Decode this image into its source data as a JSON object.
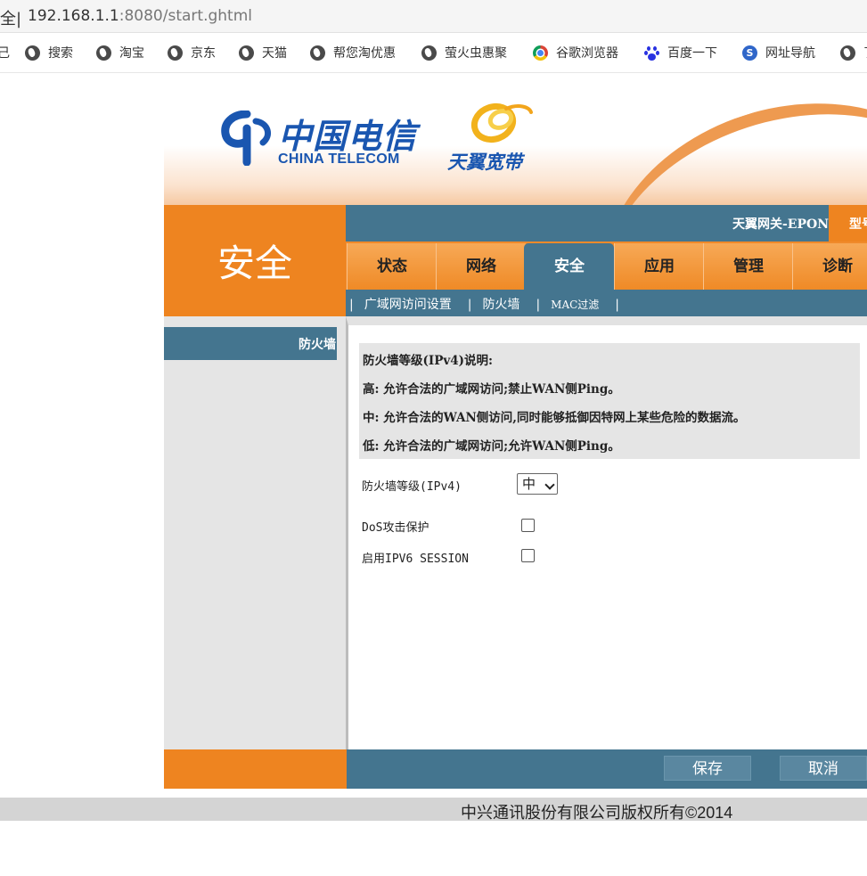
{
  "browser": {
    "address_prefix": "全",
    "url_host": "192.168.1.1",
    "url_rest": ":8080/start.ghtml",
    "bookmarks": [
      {
        "label": "搜索",
        "icon": "globe-icon"
      },
      {
        "label": "淘宝",
        "icon": "globe-icon"
      },
      {
        "label": "京东",
        "icon": "globe-icon"
      },
      {
        "label": "天猫",
        "icon": "globe-icon"
      },
      {
        "label": "帮您淘优惠",
        "icon": "globe-icon"
      },
      {
        "label": "萤火虫惠聚",
        "icon": "globe-icon"
      },
      {
        "label": "谷歌浏览器",
        "icon": "chrome-icon"
      },
      {
        "label": "百度一下",
        "icon": "baidu-paw-icon"
      },
      {
        "label": "网址导航",
        "icon": "360-icon"
      }
    ],
    "bookmark_edge_left": "己",
    "bookmark_edge_right": "了"
  },
  "header": {
    "logo_cn": "中国电信",
    "logo_en": "CHINA TELECOM",
    "brand": "天翼宽带",
    "device_name": "天翼网关-EPON",
    "model_label": "型号"
  },
  "section": {
    "title": "安全"
  },
  "tabs": [
    "状态",
    "网络",
    "安全",
    "应用",
    "管理",
    "诊断"
  ],
  "active_tab": "安全",
  "subtabs": {
    "items": [
      "广域网访问设置",
      "防火墙",
      "MAC过滤"
    ],
    "separator": "|"
  },
  "left_menu": {
    "active_item": "防火墙"
  },
  "info": {
    "title": "防火墙等级(IPv4)说明:",
    "lines": [
      "高: 允许合法的广域网访问;禁止WAN侧Ping。",
      "中: 允许合法的WAN侧访问,同时能够抵御因特网上某些危险的数据流。",
      "低: 允许合法的广域网访问;允许WAN侧Ping。"
    ]
  },
  "form": {
    "level_label": "防火墙等级(IPv4)",
    "level_value": "中",
    "dos_label": "DoS攻击保护",
    "dos_checked": false,
    "ipv6_label": "启用IPV6 SESSION",
    "ipv6_checked": false
  },
  "buttons": {
    "save": "保存",
    "cancel": "取消"
  },
  "footer": {
    "copyright": "中兴通讯股份有限公司版权所有©2014"
  },
  "colors": {
    "orange": "#ee8420",
    "steel_blue": "#44758f",
    "brand_blue": "#1a56b0"
  }
}
